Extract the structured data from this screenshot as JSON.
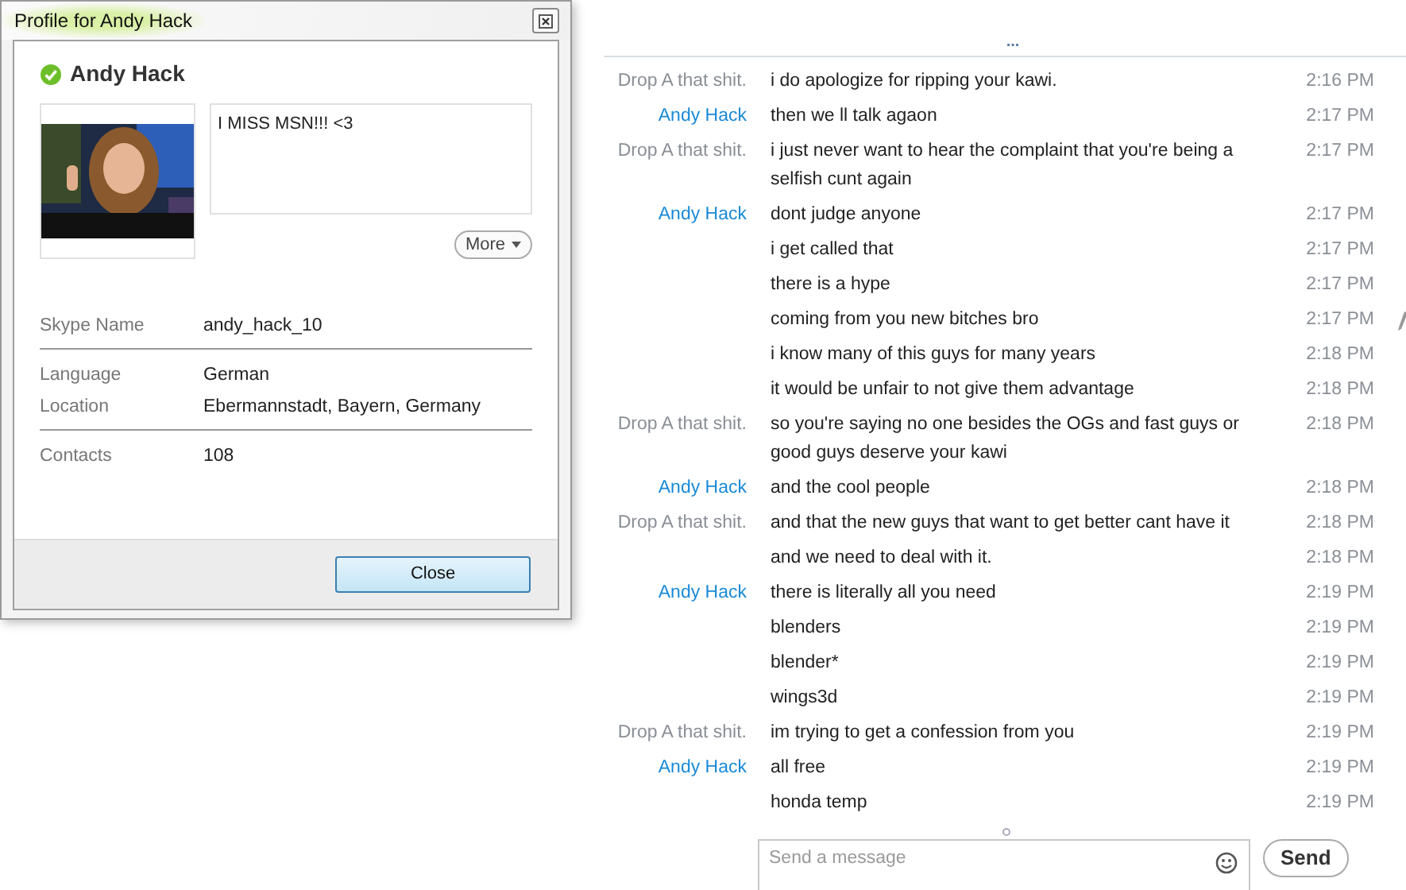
{
  "profile_dialog": {
    "title": "Profile for Andy Hack",
    "name": "Andy Hack",
    "mood": "I MISS MSN!!! <3",
    "more_button": "More",
    "details": [
      {
        "label": "Skype Name",
        "value": "andy_hack_10",
        "divider_after": true
      },
      {
        "label": "Language",
        "value": "German",
        "divider_after": false
      },
      {
        "label": "Location",
        "value": "Ebermannstadt, Bayern, Germany",
        "divider_after": true
      },
      {
        "label": "Contacts",
        "value": "108",
        "divider_after": false
      }
    ],
    "close_button": "Close"
  },
  "chat": {
    "more_indicator": "...",
    "messages": [
      {
        "sender": "Drop A that shit.",
        "kind": "incoming",
        "text": "i do apologize for ripping your kawi.",
        "time": "2:16 PM",
        "edited": false
      },
      {
        "sender": "Andy Hack",
        "kind": "outgoing",
        "text": "then we ll talk agaon",
        "time": "2:17 PM",
        "edited": false
      },
      {
        "sender": "Drop A that shit.",
        "kind": "incoming",
        "text": "i just never want to hear the complaint that you're being a selfish cunt again",
        "time": "2:17 PM",
        "edited": false
      },
      {
        "sender": "Andy Hack",
        "kind": "outgoing",
        "text": "dont judge anyone",
        "time": "2:17 PM",
        "edited": false
      },
      {
        "text": "i get called that",
        "time": "2:17 PM",
        "edited": false
      },
      {
        "text": "there is a hype",
        "time": "2:17 PM",
        "edited": false
      },
      {
        "text": "coming from you new bitches bro",
        "time": "2:17 PM",
        "edited": true
      },
      {
        "text": "i know many of this guys for many years",
        "time": "2:18 PM",
        "edited": false
      },
      {
        "text": "it would be unfair to not give them advantage",
        "time": "2:18 PM",
        "edited": false
      },
      {
        "sender": "Drop A that shit.",
        "kind": "incoming",
        "text": "so you're saying no one besides the OGs and fast guys or good guys deserve your kawi",
        "time": "2:18 PM",
        "edited": false
      },
      {
        "sender": "Andy Hack",
        "kind": "outgoing",
        "text": "and the cool people",
        "time": "2:18 PM",
        "edited": false
      },
      {
        "sender": "Drop A that shit.",
        "kind": "incoming",
        "text": "and that the new guys that want to get better cant have it",
        "time": "2:18 PM",
        "edited": false
      },
      {
        "text": "and we need to deal with it.",
        "time": "2:18 PM",
        "edited": false
      },
      {
        "sender": "Andy Hack",
        "kind": "outgoing",
        "text": "there is literally all you need",
        "time": "2:19 PM",
        "edited": false
      },
      {
        "text": "blenders",
        "time": "2:19 PM",
        "edited": false
      },
      {
        "text": "blender*",
        "time": "2:19 PM",
        "edited": false
      },
      {
        "text": "wings3d",
        "time": "2:19 PM",
        "edited": false
      },
      {
        "sender": "Drop A that shit.",
        "kind": "incoming",
        "text": "im trying to get a confession from you",
        "time": "2:19 PM",
        "edited": false
      },
      {
        "sender": "Andy Hack",
        "kind": "outgoing",
        "text": "all free",
        "time": "2:19 PM",
        "edited": false
      },
      {
        "text": "honda temp",
        "time": "2:19 PM",
        "edited": false
      }
    ],
    "message_input": {
      "placeholder": "Send a message"
    },
    "send_button": "Send"
  }
}
